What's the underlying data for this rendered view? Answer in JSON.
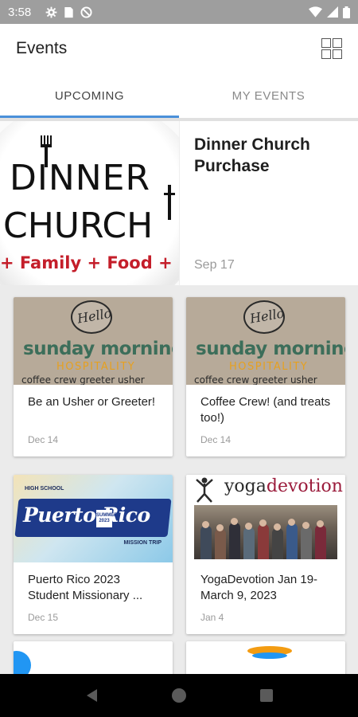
{
  "status_bar": {
    "time": "3:58",
    "icons": [
      "gear-icon",
      "sim-card-icon",
      "no-disturb-icon",
      "wifi-icon",
      "signal-icon",
      "battery-icon"
    ]
  },
  "app_bar": {
    "title": "Events",
    "layout_toggle_icon": "grid-view-icon"
  },
  "tabs": [
    {
      "label": "UPCOMING",
      "active": true
    },
    {
      "label": "MY EVENTS",
      "active": false
    }
  ],
  "featured_event": {
    "title": "Dinner Church Purchase",
    "date": "Sep 17",
    "image_text": {
      "line1": "DINNER",
      "line2": "CHURCH",
      "tagline": "+ Family + Food + F"
    }
  },
  "events": [
    {
      "title": "Be an Usher or Greeter!",
      "date": "Dec 14",
      "image_text": {
        "bubble": "Hello",
        "headline": "sunday morning",
        "sub": "HOSPITALITY",
        "footer": "coffee crew   greeter   usher"
      }
    },
    {
      "title": "Coffee Crew! (and treats too!)",
      "date": "Dec 14",
      "image_text": {
        "bubble": "Hello",
        "headline": "sunday morning",
        "sub": "HOSPITALITY",
        "footer": "coffee crew   greeter   usher"
      }
    },
    {
      "title": "Puerto Rico 2023 Student Missionary ...",
      "date": "Dec 15",
      "image_text": {
        "top": "HIGH SCHOOL",
        "headline": "Puerto Rico",
        "year": "SUMMER 2023",
        "bottom": "MISSION TRIP"
      }
    },
    {
      "title": "YogaDevotion Jan 19- March 9, 2023",
      "date": "Jan 4",
      "image_text": {
        "brand_a": "yoga",
        "brand_b": "devotion"
      }
    }
  ],
  "colors": {
    "tab_indicator": "#4a90d9",
    "status_bar": "#9e9e9e",
    "dinner_church_red": "#c41e2a",
    "sunday_green": "#3c6e5a",
    "hospitality_orange": "#e6a020",
    "puerto_rico_blue": "#1e3a8a",
    "yoga_maroon": "#9b1c3c"
  },
  "nav_bar": {
    "buttons": [
      "back-icon",
      "home-icon",
      "recents-icon"
    ]
  }
}
